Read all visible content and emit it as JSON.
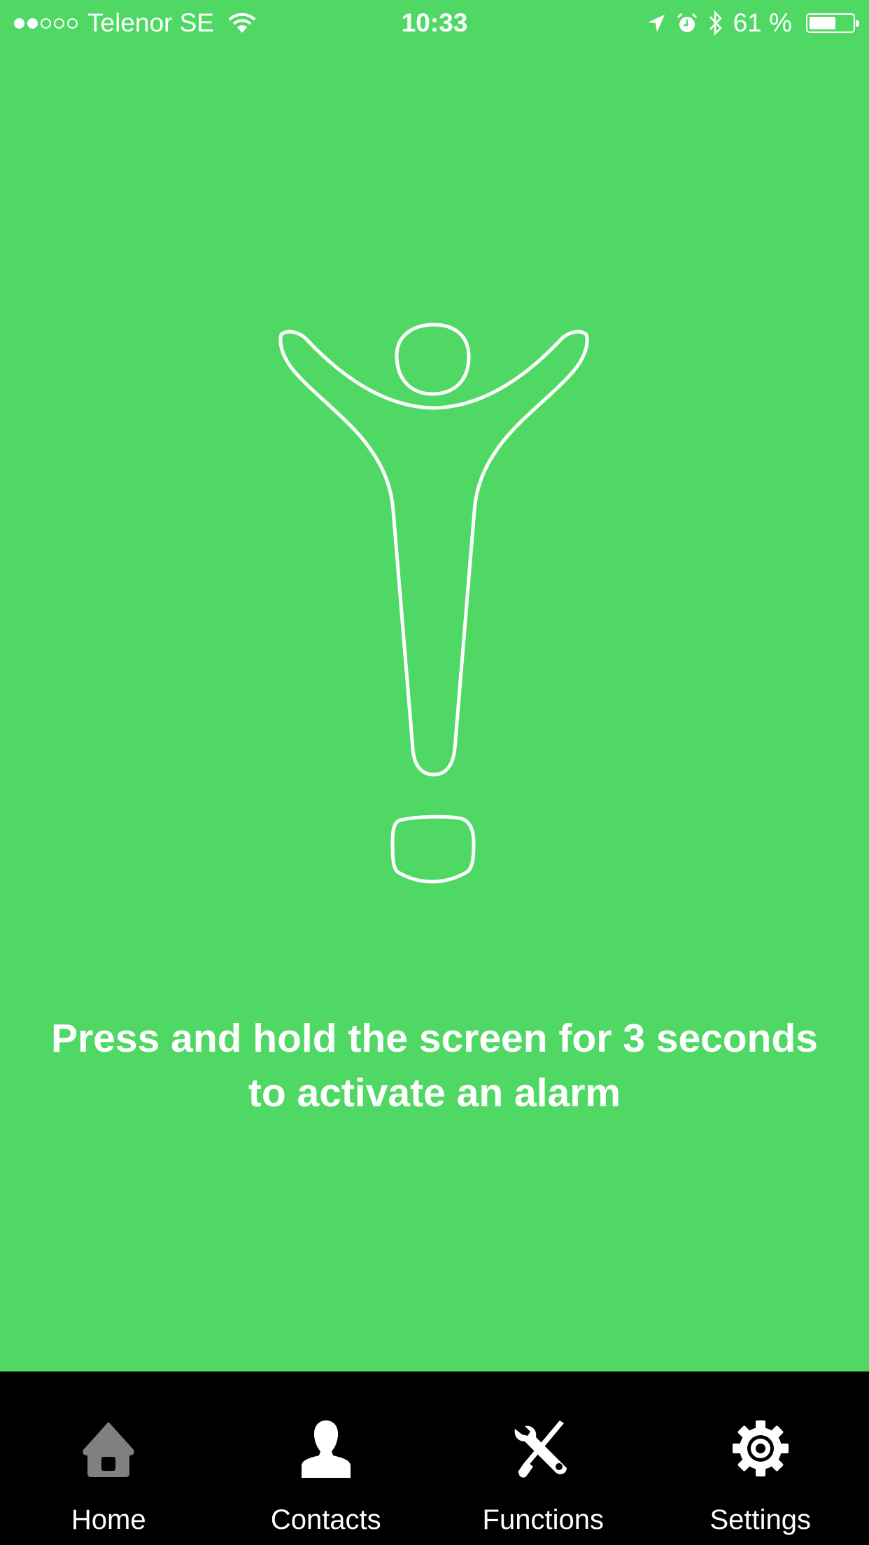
{
  "status_bar": {
    "signal_strength": 2,
    "signal_max": 5,
    "carrier": "Telenor SE",
    "time": "10:33",
    "battery_percent_text": "61 %",
    "battery_level": 0.61,
    "icons": [
      "wifi-icon",
      "location-arrow-icon",
      "alarm-clock-icon",
      "bluetooth-icon",
      "battery-icon"
    ]
  },
  "main": {
    "background_color": "#4fd964",
    "illustration": "person-exclamation-mark-icon",
    "instruction": "Press and hold the screen for 3 seconds to activate an alarm"
  },
  "tab_bar": {
    "background_color": "#000000",
    "active_index": 0,
    "items": [
      {
        "label": "Home",
        "icon": "home-icon",
        "active": true,
        "icon_color": "#808080"
      },
      {
        "label": "Contacts",
        "icon": "contact-person-icon",
        "active": false,
        "icon_color": "#ffffff"
      },
      {
        "label": "Functions",
        "icon": "tools-icon",
        "active": false,
        "icon_color": "#ffffff"
      },
      {
        "label": "Settings",
        "icon": "gear-icon",
        "active": false,
        "icon_color": "#ffffff"
      }
    ]
  }
}
